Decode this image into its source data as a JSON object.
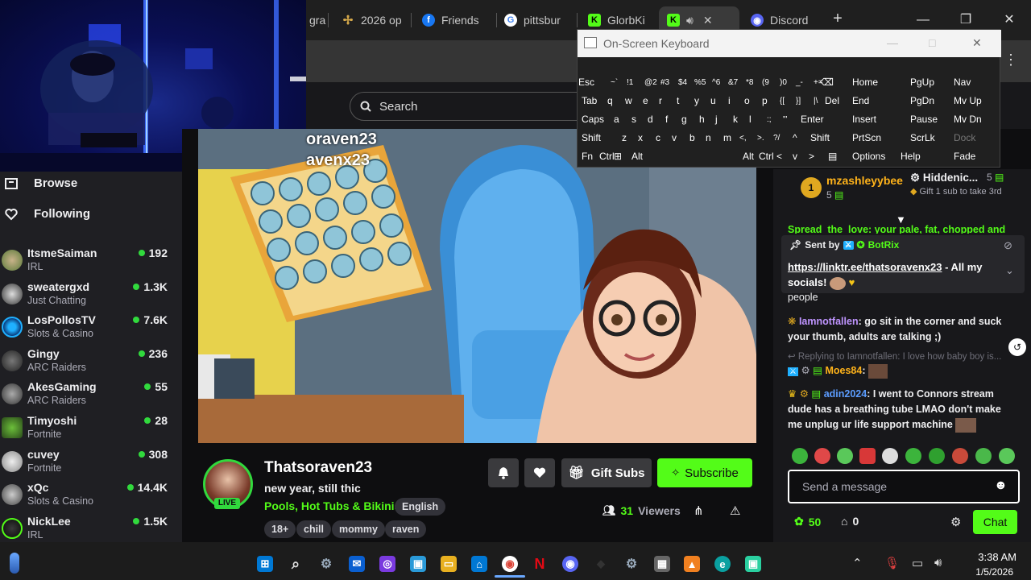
{
  "browser": {
    "tabs": [
      {
        "label": "gra",
        "icon": "page-icon"
      },
      {
        "label": "2026 op",
        "icon": "star-icon"
      },
      {
        "label": "Friends",
        "icon": "facebook-icon"
      },
      {
        "label": "pittsbur",
        "icon": "google-icon"
      },
      {
        "label": "GlorbKi",
        "icon": "kick-icon"
      },
      {
        "label": "",
        "icon": "kick-icon",
        "active": true
      },
      {
        "label": "Discord",
        "icon": "discord-icon"
      }
    ],
    "new_tab": "+",
    "minimize": "—",
    "maximize": "❐",
    "close": "✕"
  },
  "header": {
    "search_label": "Search"
  },
  "sidebar": {
    "browse": "Browse",
    "following": "Following",
    "channels": [
      {
        "name": "ItsmeSaiman",
        "category": "IRL",
        "viewers": "192"
      },
      {
        "name": "sweatergxd",
        "category": "Just Chatting",
        "viewers": "1.3K"
      },
      {
        "name": "LosPollosTV",
        "category": "Slots & Casino",
        "viewers": "7.6K"
      },
      {
        "name": "Gingy",
        "category": "ARC Raiders",
        "viewers": "236"
      },
      {
        "name": "AkesGaming",
        "category": "ARC Raiders",
        "viewers": "55"
      },
      {
        "name": "Timyoshi",
        "category": "Fortnite",
        "viewers": "28"
      },
      {
        "name": "cuvey",
        "category": "Fortnite",
        "viewers": "308"
      },
      {
        "name": "xQc",
        "category": "Slots & Casino",
        "viewers": "14.4K"
      },
      {
        "name": "NickLee",
        "category": "IRL",
        "viewers": "1.5K"
      }
    ]
  },
  "stream": {
    "overlay_line1": "oraven23",
    "overlay_line2": "avenx23",
    "channel_name": "Thatsoraven23",
    "title": "new year, still thic",
    "category": "Pools, Hot Tubs & Bikinis",
    "language": "English",
    "live_badge": "LIVE",
    "tags": [
      "18+",
      "chill",
      "mommy",
      "raven"
    ],
    "viewer_count": "31",
    "viewers_label": "Viewers",
    "gift_subs": "Gift Subs",
    "subscribe": "Subscribe"
  },
  "chat": {
    "leaderboard": [
      {
        "rank": "1",
        "name": "mzashleyybee",
        "count": "5"
      },
      {
        "name": "Hiddenic...",
        "count": "5",
        "note": "Gift 1 sub to take 3rd"
      }
    ],
    "pinned": {
      "sent_by": "Sent by",
      "bot": "BotRix",
      "link": "https://linktr.ee/thatsoravenx23",
      "text": " - All my socials!"
    },
    "partial_top": "Spread_the_love: your pale, fat, chopped and",
    "partial_people": "people",
    "messages": [
      {
        "user": "Iamnotfallen",
        "text": ": go sit in the corner and suck your thumb, adults are talking ;)",
        "color": "#bf94ff"
      },
      {
        "reply": "Replying to Iamnotfallen: I love how baby boy is..."
      },
      {
        "user": "Moes84",
        "text": ":",
        "color": "#ffb31a"
      },
      {
        "user": "adin2024",
        "text": ": I went to Connors stream dude has a breathing tube LMAO don't make me unplug ur life support machine",
        "color": "#5c9dff"
      }
    ],
    "input_placeholder": "Send a message",
    "points": "50",
    "drops": "0",
    "chat_button": "Chat"
  },
  "osk": {
    "title": "On-Screen Keyboard",
    "row1": [
      "Esc",
      "~`",
      "!1",
      "@2",
      "#3",
      "$4",
      "%5",
      "^6",
      "&7",
      "*8",
      "(9",
      ")0",
      "_-",
      "+=",
      "⌫",
      "Home",
      "PgUp",
      "Nav"
    ],
    "row2": [
      "Tab",
      "q",
      "w",
      "e",
      "r",
      "t",
      "y",
      "u",
      "i",
      "o",
      "p",
      "{[",
      "}]",
      "|\\",
      "Del",
      "End",
      "PgDn",
      "Mv Up"
    ],
    "row3": [
      "Caps",
      "a",
      "s",
      "d",
      "f",
      "g",
      "h",
      "j",
      "k",
      "l",
      ":;",
      "\"'",
      "Enter",
      "Insert",
      "Pause",
      "Mv Dn"
    ],
    "row4": [
      "Shift",
      "z",
      "x",
      "c",
      "v",
      "b",
      "n",
      "m",
      "<,",
      ">.",
      "?/",
      "^",
      "Shift",
      "PrtScn",
      "ScrLk",
      "Dock"
    ],
    "row5": [
      "Fn",
      "Ctrl",
      "⊞",
      "Alt",
      "Alt",
      "Ctrl",
      "<",
      "v",
      ">",
      "▤",
      "Options",
      "Help",
      "Fade"
    ]
  },
  "taskbar": {
    "time": "3:38 AM",
    "date": "1/5/2026"
  }
}
